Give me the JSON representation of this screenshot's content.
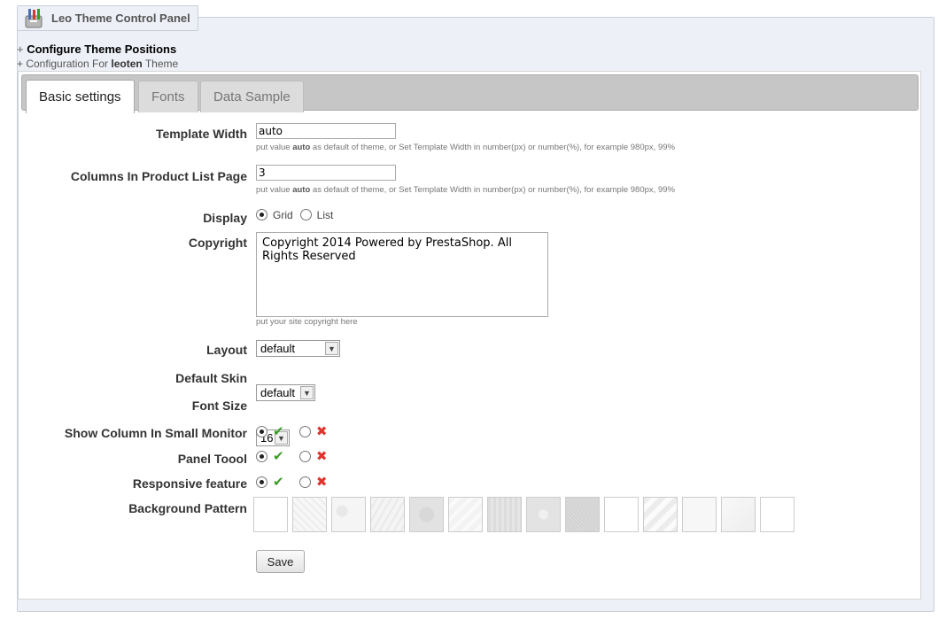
{
  "legend": {
    "title": "Leo Theme Control Panel",
    "logo_icon": "palette-brushes-icon"
  },
  "heading": {
    "prefix": "+ ",
    "title": "Configure Theme Positions"
  },
  "subheading": {
    "prefix": "+ Configuration For ",
    "theme": "leoten",
    "suffix": " Theme"
  },
  "tabs": [
    {
      "label": "Basic settings",
      "active": true
    },
    {
      "label": "Fonts",
      "active": false
    },
    {
      "label": "Data Sample",
      "active": false
    }
  ],
  "form": {
    "template_width": {
      "label": "Template Width",
      "value": "auto",
      "hint_pre": "put value ",
      "hint_bold": "auto",
      "hint_post": " as default of theme, or Set Template Width in number(px) or number(%), for example 980px, 99%"
    },
    "columns": {
      "label": "Columns In Product List Page",
      "value": "3",
      "hint_pre": "put value ",
      "hint_bold": "auto",
      "hint_post": " as default of theme, or Set Template Width in number(px) or number(%), for example 980px, 99%"
    },
    "display": {
      "label": "Display",
      "options": [
        "Grid",
        "List"
      ],
      "selected": "Grid"
    },
    "copyright": {
      "label": "Copyright",
      "value": "Copyright 2014 Powered by PrestaShop. All Rights Reserved",
      "hint": "put your site copyright here"
    },
    "layout": {
      "label": "Layout",
      "value": "default"
    },
    "default_skin": {
      "label": "Default Skin",
      "value": "default"
    },
    "font_size": {
      "label": "Font Size",
      "value": "16"
    },
    "show_column": {
      "label": "Show Column In Small Monitor",
      "selected": "yes"
    },
    "panel_toool": {
      "label": "Panel Toool",
      "selected": "yes"
    },
    "responsive": {
      "label": "Responsive feature",
      "selected": "yes"
    },
    "background_pattern": {
      "label": "Background Pattern",
      "count": 14
    },
    "save_label": "Save"
  }
}
